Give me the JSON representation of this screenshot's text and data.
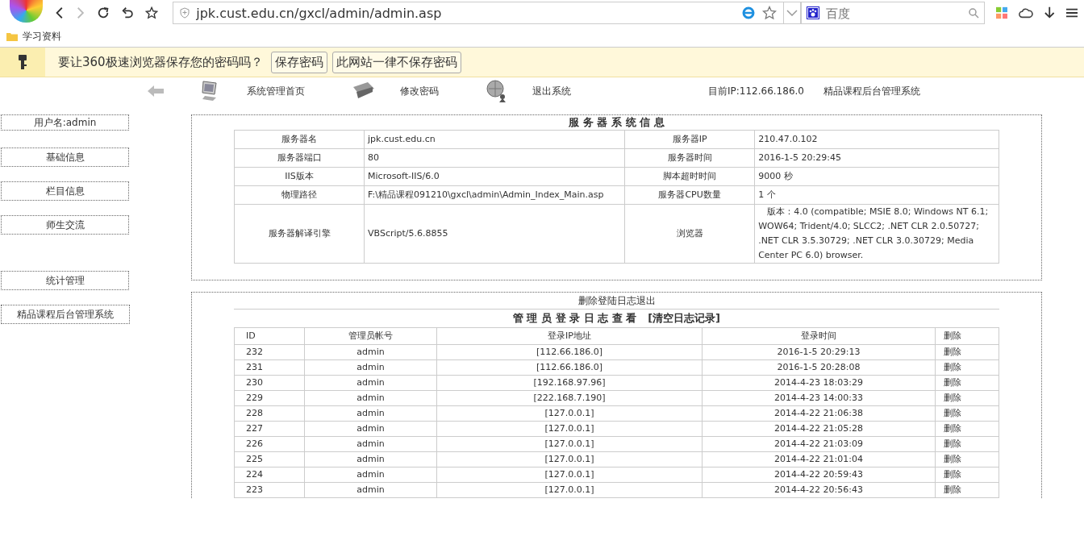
{
  "browser": {
    "url": "jpk.cust.edu.cn/gxcl/admin/admin.asp",
    "search": {
      "placeholder": "百度"
    },
    "bookmarks": [
      "学习资料"
    ]
  },
  "infobar": {
    "message": "要让360极速浏览器保存您的密码吗？",
    "buttons": [
      "保存密码",
      "此网站一律不保存密码"
    ]
  },
  "nav": {
    "items": [
      {
        "kind": "monitor",
        "label": "系统管理首页"
      },
      {
        "kind": "tools",
        "label": "修改密码"
      },
      {
        "kind": "globe",
        "label": "退出系统"
      }
    ],
    "ip": "目前IP:112.66.186.0",
    "system": "精品课程后台管理系统"
  },
  "sidebar": {
    "items": [
      "用户名:admin",
      "基础信息",
      "栏目信息",
      "师生交流",
      "统计管理",
      "精品课程后台管理系统"
    ]
  },
  "server_info": {
    "title": "服 务 器 系 统 信 息",
    "rows": [
      [
        "服务器名",
        "jpk.cust.edu.cn",
        "服务器IP",
        "210.47.0.102"
      ],
      [
        "服务器端口",
        "80",
        "服务器时间",
        "2016-1-5 20:29:45"
      ],
      [
        "IIS版本",
        "Microsoft-IIS/6.0",
        "脚本超时时间",
        "9000 秒"
      ],
      [
        "物理路径",
        "F:\\精品课程091210\\gxcl\\admin\\Admin_Index_Main.asp",
        "服务器CPU数量",
        "1 个"
      ],
      [
        "服务器解译引擎",
        "VBScript/5.6.8855",
        "浏览器",
        "　版本：4.0 (compatible; MSIE 8.0; Windows NT 6.1; WOW64; Trident/4.0; SLCC2; .NET CLR 2.0.50727; .NET CLR 3.5.30729; .NET CLR 3.0.30729; Media Center PC 6.0) browser."
      ]
    ]
  },
  "log": {
    "links": "删除登陆日志退出",
    "title": "管 理 员 登 录 日 志 查 看",
    "clear_link": "[清空日志记录]",
    "columns": [
      "ID",
      "管理员帐号",
      "登录IP地址",
      "登录时间",
      "删除"
    ],
    "rows": [
      [
        "232",
        "admin",
        "[112.66.186.0]",
        "2016-1-5 20:29:13",
        "删除"
      ],
      [
        "231",
        "admin",
        "[112.66.186.0]",
        "2016-1-5 20:28:08",
        "删除"
      ],
      [
        "230",
        "admin",
        "[192.168.97.96]",
        "2014-4-23 18:03:29",
        "删除"
      ],
      [
        "229",
        "admin",
        "[222.168.7.190]",
        "2014-4-23 14:00:33",
        "删除"
      ],
      [
        "228",
        "admin",
        "[127.0.0.1]",
        "2014-4-22 21:06:38",
        "删除"
      ],
      [
        "227",
        "admin",
        "[127.0.0.1]",
        "2014-4-22 21:05:28",
        "删除"
      ],
      [
        "226",
        "admin",
        "[127.0.0.1]",
        "2014-4-22 21:03:09",
        "删除"
      ],
      [
        "225",
        "admin",
        "[127.0.0.1]",
        "2014-4-22 21:01:04",
        "删除"
      ],
      [
        "224",
        "admin",
        "[127.0.0.1]",
        "2014-4-22 20:59:43",
        "删除"
      ],
      [
        "223",
        "admin",
        "[127.0.0.1]",
        "2014-4-22 20:56:43",
        "删除"
      ]
    ]
  }
}
